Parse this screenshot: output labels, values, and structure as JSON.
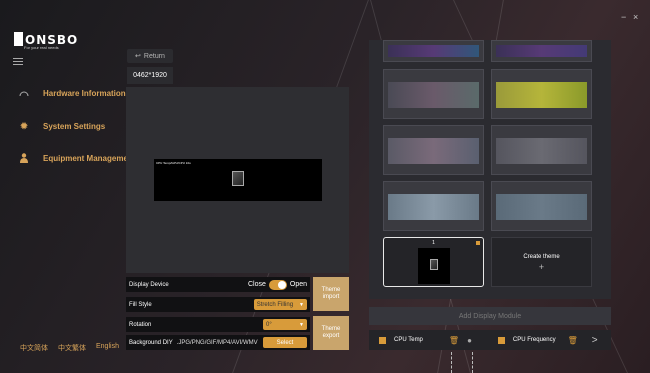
{
  "window": {
    "minimize": "−",
    "close": "×"
  },
  "logo": {
    "text": "ONSBO",
    "tagline": "For your real needs"
  },
  "sidebar": {
    "items": [
      {
        "label": "Hardware Information",
        "icon": "gauge-icon"
      },
      {
        "label": "System Settings",
        "icon": "gear-icon"
      },
      {
        "label": "Equipment Management",
        "icon": "user-icon"
      }
    ],
    "languages": [
      "中文简体",
      "中文繁体",
      "English"
    ]
  },
  "editor": {
    "return_label": "Return",
    "resolution": "0462*1920",
    "preview_text": "CPU Temp/GPU/CPU Info",
    "display_device": {
      "label": "Display Device",
      "off": "Close",
      "on": "Open",
      "value": true
    },
    "fill_style": {
      "label": "Fill Style",
      "value": "Stretch Filling"
    },
    "rotation": {
      "label": "Rotation",
      "value": "0°"
    },
    "background": {
      "label": "Background DIY",
      "formats": ".JPG/PNG/GIF/MP4/AVI/WMV",
      "select": "Select"
    },
    "theme_import": "Theme import",
    "theme_export": "Theme export"
  },
  "themes": {
    "selected_number": "1",
    "create_label": "Create theme",
    "create_plus": "+"
  },
  "modules": {
    "add_label": "Add Display Module",
    "items": [
      "CPU Temp",
      "CPU Frequency"
    ],
    "more": ">"
  },
  "colors": {
    "accent": "#d89b3a",
    "panel": "#2b2b30"
  }
}
